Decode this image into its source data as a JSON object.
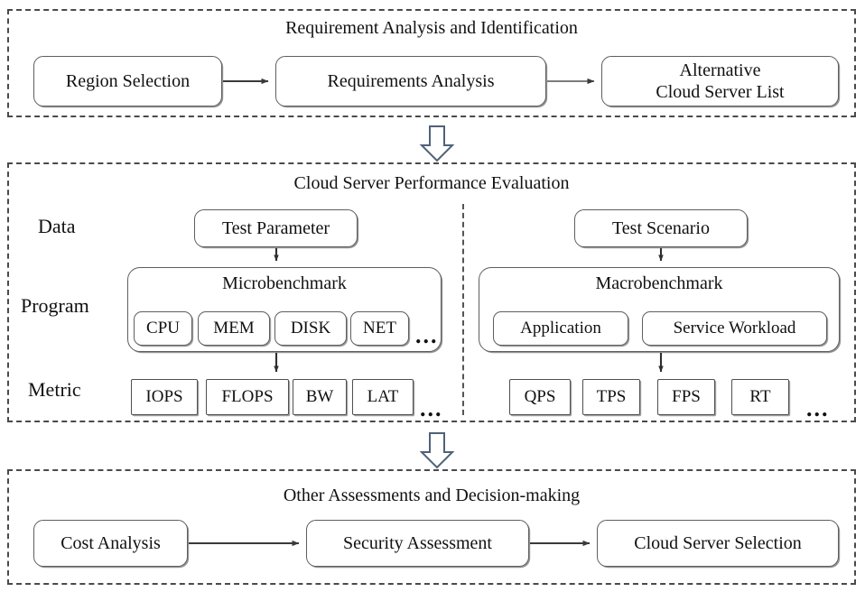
{
  "figure": {
    "kind": "flow-diagram",
    "stages": [
      {
        "id": "requirement",
        "title": "Requirement Analysis and Identification",
        "nodes": [
          {
            "label": "Region Selection"
          },
          {
            "label": "Requirements Analysis"
          },
          {
            "label_line1": "Alternative",
            "label_line2": "Cloud Server List"
          }
        ]
      },
      {
        "id": "evaluation",
        "title": "Cloud Server Performance Evaluation",
        "row_labels": {
          "data": "Data",
          "program": "Program",
          "metric": "Metric"
        },
        "left": {
          "data_node": "Test Parameter",
          "program_group": "Microbenchmark",
          "program_items": [
            "CPU",
            "MEM",
            "DISK",
            "NET"
          ],
          "program_more": "...",
          "metrics": [
            "IOPS",
            "FLOPS",
            "BW",
            "LAT"
          ],
          "metrics_more": "..."
        },
        "right": {
          "data_node": "Test Scenario",
          "program_group": "Macrobenchmark",
          "program_items": [
            "Application",
            "Service Workload"
          ],
          "metrics": [
            "QPS",
            "TPS",
            "FPS",
            "RT"
          ],
          "metrics_more": "..."
        }
      },
      {
        "id": "decision",
        "title": "Other Assessments and Decision-making",
        "nodes": [
          {
            "label": "Cost Analysis"
          },
          {
            "label": "Security Assessment"
          },
          {
            "label": "Cloud Server Selection"
          }
        ]
      }
    ],
    "stage_connectors": [
      {
        "from": "requirement",
        "to": "evaluation",
        "shape": "block-down-arrow"
      },
      {
        "from": "evaluation",
        "to": "decision",
        "shape": "block-down-arrow"
      }
    ],
    "colors": {
      "panel_border": "#4a4a4a",
      "node_border": "#5e5e5e",
      "arrow": "#3a3a3a",
      "block_arrow_stroke": "#4f6277",
      "background": "#ffffff",
      "text": "#111111"
    }
  }
}
